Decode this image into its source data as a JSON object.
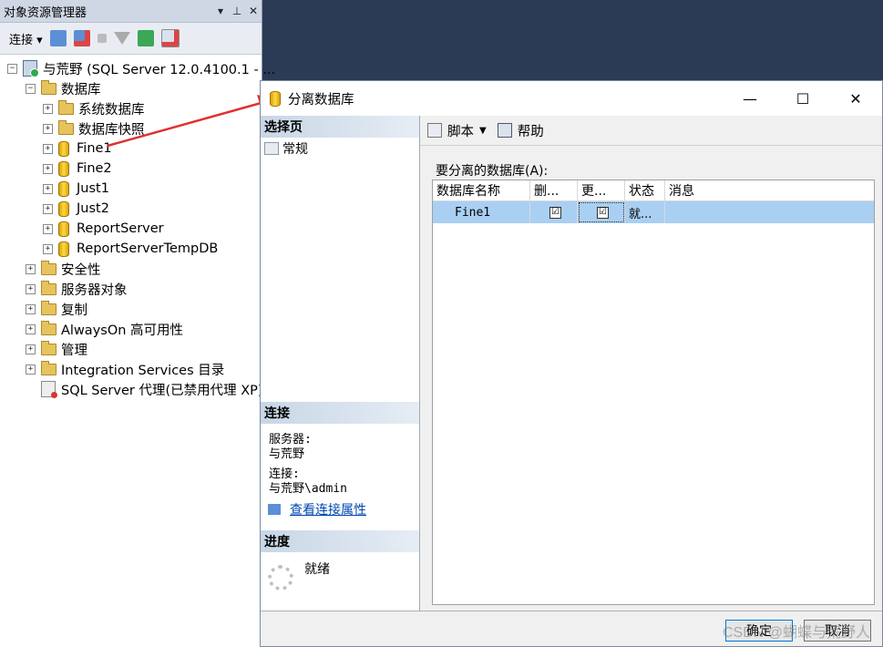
{
  "object_explorer": {
    "title": "对象资源管理器",
    "title_controls": [
      "▾",
      "⊥",
      "✕"
    ],
    "toolbar": {
      "connect_label": "连接",
      "icons": [
        "connect-icon",
        "disconnect-icon",
        "stop-icon",
        "filter-icon",
        "refresh-icon",
        "summary-icon"
      ]
    },
    "tree": {
      "server": "与荒野 (SQL Server 12.0.4100.1 - ...",
      "databases": "数据库",
      "db_children": [
        "系统数据库",
        "数据库快照"
      ],
      "databases_list": [
        "Fine1",
        "Fine2",
        "Just1",
        "Just2",
        "ReportServer",
        "ReportServerTempDB"
      ],
      "server_children": [
        "安全性",
        "服务器对象",
        "复制",
        "AlwaysOn 高可用性",
        "管理",
        "Integration Services 目录"
      ],
      "agent": "SQL Server 代理(已禁用代理 XP)"
    }
  },
  "dialog": {
    "title": "分离数据库",
    "window_controls": [
      "—",
      "☐",
      "✕"
    ],
    "select_page_header": "选择页",
    "pages": [
      "常规"
    ],
    "connection_header": "连接",
    "server_label": "服务器:",
    "server_value": "与荒野",
    "connection_label": "连接:",
    "connection_value": "与荒野\\admin",
    "view_connection_link": "查看连接属性",
    "progress_header": "进度",
    "progress_status": "就绪",
    "toolbar": {
      "script_label": "脚本",
      "help_label": "帮助"
    },
    "grid_label": "要分离的数据库(A):",
    "grid_columns": [
      "数据库名称",
      "删...",
      "更...",
      "状态",
      "消息"
    ],
    "grid_rows": [
      {
        "name": "Fine1",
        "drop": "☑",
        "update": "☑",
        "status": "就...",
        "message": ""
      }
    ],
    "ok_label": "确定",
    "cancel_label": "取消"
  },
  "watermark": "CSDN @蝴蝶与荒野人"
}
